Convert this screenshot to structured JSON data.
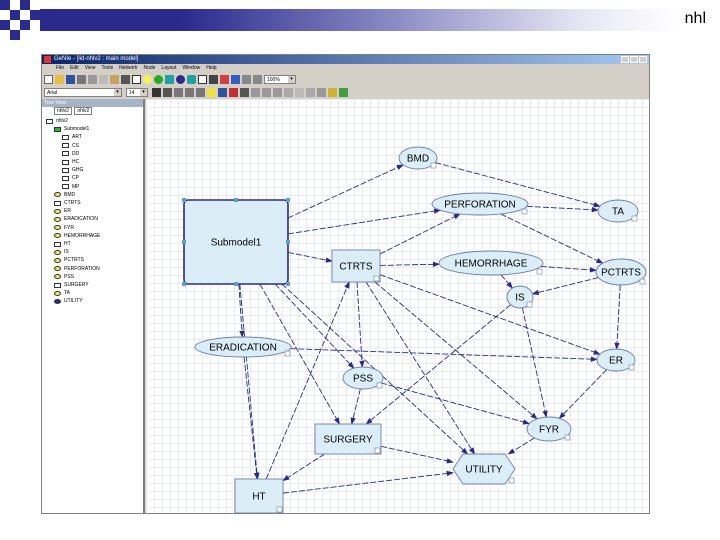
{
  "slide": {
    "label": "nhl"
  },
  "window": {
    "title": "GeNIe - [lid-nhlv2 : main model]",
    "menu": [
      "File",
      "Edit",
      "View",
      "Tools",
      "Network",
      "Node",
      "Layout",
      "Window",
      "Help"
    ],
    "zoom": "100%",
    "font_name": "Arial",
    "font_size": "14"
  },
  "tree": {
    "header": "Tree View",
    "tabs": [
      "nhlv2",
      "nhlv2"
    ],
    "items": [
      {
        "label": "nhlv2",
        "level": 0,
        "icon": "network-icon"
      },
      {
        "label": "Submodel1",
        "level": 1,
        "icon": "submodel-icon"
      },
      {
        "label": "ART",
        "level": 2,
        "icon": "decision-node-icon"
      },
      {
        "label": "CS",
        "level": 2,
        "icon": "decision-node-icon"
      },
      {
        "label": "DD",
        "level": 2,
        "icon": "decision-node-icon"
      },
      {
        "label": "HC",
        "level": 2,
        "icon": "decision-node-icon"
      },
      {
        "label": "GHG",
        "level": 2,
        "icon": "decision-node-icon"
      },
      {
        "label": "CP",
        "level": 2,
        "icon": "decision-node-icon"
      },
      {
        "label": "MP",
        "level": 2,
        "icon": "decision-node-icon"
      },
      {
        "label": "BMD",
        "level": 1,
        "icon": "chance-node-icon"
      },
      {
        "label": "CTRTS",
        "level": 1,
        "icon": "decision-node-icon"
      },
      {
        "label": "ER",
        "level": 1,
        "icon": "chance-node-icon"
      },
      {
        "label": "ERADICATION",
        "level": 1,
        "icon": "chance-node-icon"
      },
      {
        "label": "FYR",
        "level": 1,
        "icon": "chance-node-icon"
      },
      {
        "label": "HEMORRHAGE",
        "level": 1,
        "icon": "chance-node-icon"
      },
      {
        "label": "HT",
        "level": 1,
        "icon": "decision-node-icon"
      },
      {
        "label": "IS",
        "level": 1,
        "icon": "chance-node-icon"
      },
      {
        "label": "PCTRTS",
        "level": 1,
        "icon": "chance-node-icon"
      },
      {
        "label": "PERFORATION",
        "level": 1,
        "icon": "chance-node-icon"
      },
      {
        "label": "PSS",
        "level": 1,
        "icon": "chance-node-icon"
      },
      {
        "label": "SURGERY",
        "level": 1,
        "icon": "decision-node-icon"
      },
      {
        "label": "TA",
        "level": 1,
        "icon": "chance-node-icon"
      },
      {
        "label": "UTILITY",
        "level": 1,
        "icon": "utility-node-icon"
      }
    ]
  },
  "graph": {
    "nodes": [
      {
        "id": "Submodel1",
        "label": "Submodel1",
        "kind": "submodel"
      },
      {
        "id": "BMD",
        "label": "BMD",
        "kind": "chance"
      },
      {
        "id": "PERFORATION",
        "label": "PERFORATION",
        "kind": "chance"
      },
      {
        "id": "TA",
        "label": "TA",
        "kind": "chance"
      },
      {
        "id": "CTRTS",
        "label": "CTRTS",
        "kind": "decision"
      },
      {
        "id": "HEMORRHAGE",
        "label": "HEMORRHAGE",
        "kind": "chance"
      },
      {
        "id": "PCTRTS",
        "label": "PCTRTS",
        "kind": "chance"
      },
      {
        "id": "IS",
        "label": "IS",
        "kind": "chance"
      },
      {
        "id": "ERADICATION",
        "label": "ERADICATION",
        "kind": "chance"
      },
      {
        "id": "ER",
        "label": "ER",
        "kind": "chance"
      },
      {
        "id": "PSS",
        "label": "PSS",
        "kind": "chance"
      },
      {
        "id": "SURGERY",
        "label": "SURGERY",
        "kind": "decision"
      },
      {
        "id": "FYR",
        "label": "FYR",
        "kind": "chance"
      },
      {
        "id": "UTILITY",
        "label": "UTILITY",
        "kind": "utility"
      },
      {
        "id": "HT",
        "label": "HT",
        "kind": "decision"
      }
    ],
    "edges": [
      [
        "Submodel1",
        "BMD"
      ],
      [
        "Submodel1",
        "PERFORATION"
      ],
      [
        "Submodel1",
        "CTRTS"
      ],
      [
        "Submodel1",
        "ERADICATION"
      ],
      [
        "Submodel1",
        "PSS"
      ],
      [
        "Submodel1",
        "SURGERY"
      ],
      [
        "Submodel1",
        "UTILITY"
      ],
      [
        "Submodel1",
        "HT"
      ],
      [
        "BMD",
        "TA"
      ],
      [
        "PERFORATION",
        "TA"
      ],
      [
        "PERFORATION",
        "PCTRTS"
      ],
      [
        "CTRTS",
        "HEMORRHAGE"
      ],
      [
        "CTRTS",
        "PERFORATION"
      ],
      [
        "CTRTS",
        "ER"
      ],
      [
        "CTRTS",
        "PSS"
      ],
      [
        "CTRTS",
        "FYR"
      ],
      [
        "CTRTS",
        "UTILITY"
      ],
      [
        "HEMORRHAGE",
        "PCTRTS"
      ],
      [
        "HEMORRHAGE",
        "IS"
      ],
      [
        "PCTRTS",
        "IS"
      ],
      [
        "PCTRTS",
        "ER"
      ],
      [
        "IS",
        "SURGERY"
      ],
      [
        "IS",
        "FYR"
      ],
      [
        "ERADICATION",
        "ER"
      ],
      [
        "ERADICATION",
        "HT"
      ],
      [
        "PSS",
        "SURGERY"
      ],
      [
        "PSS",
        "FYR"
      ],
      [
        "SURGERY",
        "UTILITY"
      ],
      [
        "SURGERY",
        "HT"
      ],
      [
        "HT",
        "CTRTS"
      ],
      [
        "HT",
        "UTILITY"
      ],
      [
        "FYR",
        "UTILITY"
      ],
      [
        "ER",
        "FYR"
      ]
    ]
  },
  "colors": {
    "node_fill": "#dbeef7",
    "edge": "#2a2a8c",
    "accent": "#2a2a8c"
  }
}
